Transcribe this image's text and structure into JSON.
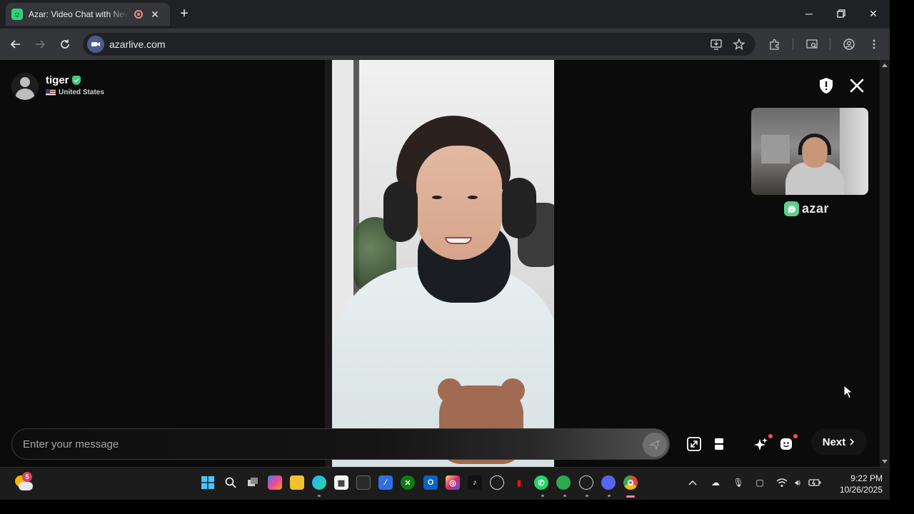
{
  "browser": {
    "tab_title": "Azar: Video Chat with New Friends",
    "url": "azarlive.com"
  },
  "profile": {
    "name": "tiger",
    "country": "United States"
  },
  "brand": {
    "name": "azar",
    "accent": "#5cd18a"
  },
  "message_bar": {
    "placeholder": "Enter your message"
  },
  "controls": {
    "next_label": "Next"
  },
  "taskbar": {
    "weather_badge": "5",
    "time": "9:22 PM",
    "date": "10/26/2025"
  },
  "icons": [
    "shield-icon",
    "close-icon",
    "send-icon",
    "expand-icon",
    "layout-icon",
    "sparkle-icon",
    "emoji-icon",
    "chevron-right-icon"
  ]
}
